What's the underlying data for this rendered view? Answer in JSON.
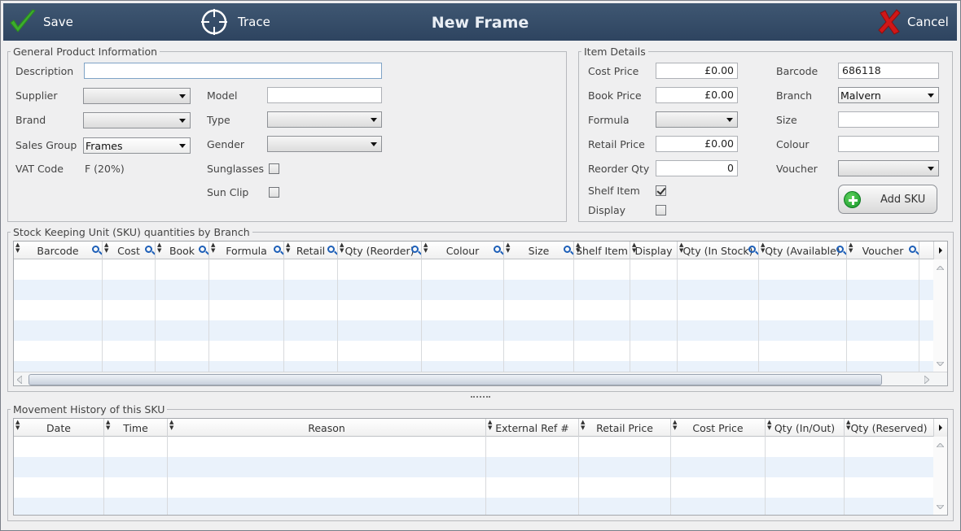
{
  "toolbar": {
    "save_label": "Save",
    "trace_label": "Trace",
    "title": "New Frame",
    "cancel_label": "Cancel"
  },
  "general": {
    "legend": "General Product Information",
    "description_label": "Description",
    "description_value": "",
    "supplier_label": "Supplier",
    "supplier_value": "",
    "brand_label": "Brand",
    "brand_value": "",
    "sales_group_label": "Sales Group",
    "sales_group_value": "Frames",
    "vat_label": "VAT Code",
    "vat_value": "F (20%)",
    "model_label": "Model",
    "model_value": "",
    "type_label": "Type",
    "type_value": "",
    "gender_label": "Gender",
    "gender_value": "",
    "sunglasses_label": "Sunglasses",
    "sunglasses_checked": false,
    "sunclip_label": "Sun Clip",
    "sunclip_checked": false
  },
  "item": {
    "legend": "Item Details",
    "cost_label": "Cost Price",
    "cost_value": "£0.00",
    "book_label": "Book Price",
    "book_value": "£0.00",
    "formula_label": "Formula",
    "formula_value": "",
    "retail_label": "Retail Price",
    "retail_value": "£0.00",
    "reorder_label": "Reorder Qty",
    "reorder_value": "0",
    "shelf_label": "Shelf Item",
    "shelf_checked": true,
    "display_label": "Display",
    "display_checked": false,
    "barcode_label": "Barcode",
    "barcode_value": "686118",
    "branch_label": "Branch",
    "branch_value": "Malvern",
    "size_label": "Size",
    "size_value": "",
    "colour_label": "Colour",
    "colour_value": "",
    "voucher_label": "Voucher",
    "voucher_value": "",
    "add_sku_label": "Add SKU"
  },
  "sku": {
    "legend": "Stock Keeping Unit (SKU) quantities by Branch",
    "columns": [
      "Barcode",
      "Cost",
      "Book",
      "Formula",
      "Retail",
      "Qty (Reorder)",
      "Colour",
      "Size",
      "Shelf Item",
      "Display",
      "Qty (In Stock)",
      "Qty (Available)",
      "Voucher"
    ]
  },
  "movement": {
    "legend": "Movement History of this SKU",
    "columns": [
      "Date",
      "Time",
      "Reason",
      "External Ref #",
      "Retail Price",
      "Cost Price",
      "Qty (In/Out)",
      "Qty (Reserved)"
    ]
  },
  "colors": {
    "toolbar_bg": "#34495f",
    "row_alt": "#eaf2fb",
    "accent_blue": "#1d5fb8",
    "cancel_red": "#d01717",
    "check_green": "#3cae2c"
  }
}
